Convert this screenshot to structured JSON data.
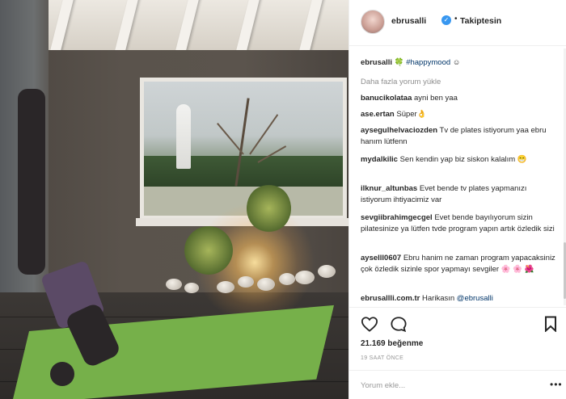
{
  "post": {
    "image_alt": "",
    "header": {
      "username": "ebrusalli",
      "separator": "•",
      "follow_status": "Takiptesin"
    },
    "caption": {
      "username": "ebrusalli",
      "emoji": "🍀",
      "hashtag": "#happymood",
      "smiley": "☺"
    },
    "load_more": "Daha fazla yorum yükle",
    "comments": [
      {
        "user": "banucikolataa",
        "text": "ayni ben yaa"
      },
      {
        "user": "ase.ertan",
        "text": "Süper👌"
      },
      {
        "user": "aysegulhelvaciozden",
        "text": "Tv de plates istiyorum yaa ebru hanım lütfenn"
      },
      {
        "user": "mydalkilic",
        "text": "Sen kendin yap biz siskon kalalım 😁"
      },
      {
        "user": "ilknur_altunbas",
        "text": "Evet bende tv plates yapmanızı istiyorum ihtiyacimiz var"
      },
      {
        "user": "sevgiibrahimgecgel",
        "text": "Evet bende bayılıyorum sizin pilatesinize ya lütfen tvde program yapın artık özledik sizi"
      },
      {
        "user": "ayselll0607",
        "text": "Ebru hanim ne zaman program yapacaksiniz çok özledik sizinle spor yapmayı sevgiler 🌸 🌸 🌺"
      },
      {
        "user": "ebrusallli.com.tr",
        "text": "Harikasın ",
        "mention": "@ebrusalli"
      }
    ],
    "likes": "21.169 beğenme",
    "time_ago": "19 SAAT ÖNCE",
    "add_comment_placeholder": "Yorum ekle...",
    "more_options": "•••"
  },
  "icons": {
    "verified": "verified-badge-icon",
    "like": "heart-icon",
    "comment": "comment-bubble-icon",
    "save": "bookmark-icon"
  },
  "colors": {
    "link": "#003569",
    "verified_blue": "#3897f0",
    "muted": "#8e8e8e",
    "mat_green": "#76b04a"
  }
}
